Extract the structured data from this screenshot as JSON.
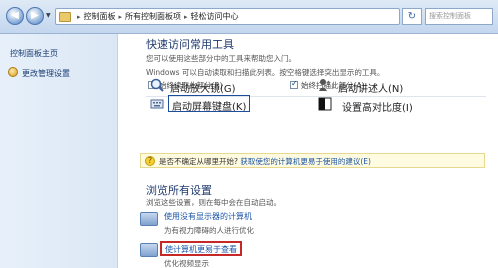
{
  "address_bar": {
    "crumbs": [
      "控制面板",
      "所有控制面板项",
      "轻松访问中心"
    ],
    "search_placeholder": "搜索控制面板"
  },
  "sidebar": {
    "home": "控制面板主页",
    "admin": "更改管理设置"
  },
  "quick": {
    "title": "快速访问常用工具",
    "line1": "您可以使用这些部分中的工具来帮助您入门。",
    "line2": "Windows 可以自动读取和扫描此列表。按空格键选择突出显示的工具。",
    "cb1": "始终读取此部分(R)",
    "cb2": "始终扫描此部分(A)",
    "tools": {
      "magnifier": "启动放大镜(G)",
      "narrator": "启动讲述人(N)",
      "keyboard": "启动屏幕键盘(K)",
      "contrast": "设置高对比度(I)"
    }
  },
  "hint": {
    "prefix": "是否不确定从哪里开始?",
    "link": "获取使您的计算机更易于使用的建议(E)"
  },
  "browse": {
    "title": "浏览所有设置",
    "desc": "浏览这些设置，则在每中会在自动启动。",
    "opt1_link": "使用没有显示器的计算机",
    "opt1_desc": "为有视力障碍的人进行优化",
    "opt2_link": "使计算机更易于查看",
    "opt2_desc": "优化视频显示"
  },
  "colors": {
    "link": "#1a54a8",
    "highlight_red": "#c62828"
  }
}
